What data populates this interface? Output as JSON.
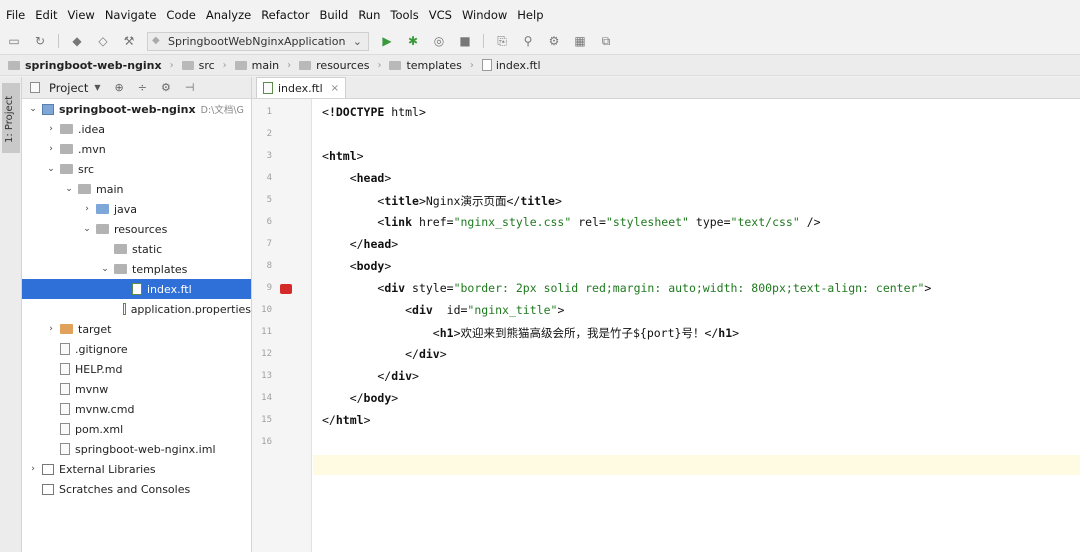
{
  "menu": [
    "File",
    "Edit",
    "View",
    "Navigate",
    "Code",
    "Analyze",
    "Refactor",
    "Build",
    "Run",
    "Tools",
    "VCS",
    "Window",
    "Help"
  ],
  "toolbar": {
    "run_configuration": "SpringbootWebNginxApplication",
    "icons": [
      "save-icon",
      "sync-icon",
      "back-icon",
      "forward-icon",
      "build-icon",
      "run-icon",
      "debug-icon",
      "coverage-icon",
      "stop-icon",
      "rebuild-icon",
      "wrench-icon",
      "settings-icon",
      "structure-icon",
      "vcs-icon"
    ]
  },
  "breadcrumb": [
    "springboot-web-nginx",
    "src",
    "main",
    "resources",
    "templates",
    "index.ftl"
  ],
  "left_tool_tab": "1: Project",
  "project_panel": {
    "title": "Project",
    "tree": [
      {
        "label": "springboot-web-nginx",
        "path": "D:\\文档\\G",
        "depth": 0,
        "arrow": "down",
        "icon": "module"
      },
      {
        "label": ".idea",
        "depth": 1,
        "arrow": "right",
        "icon": "folder"
      },
      {
        "label": ".mvn",
        "depth": 1,
        "arrow": "right",
        "icon": "folder"
      },
      {
        "label": "src",
        "depth": 1,
        "arrow": "down",
        "icon": "folder"
      },
      {
        "label": "main",
        "depth": 2,
        "arrow": "down",
        "icon": "folder"
      },
      {
        "label": "java",
        "depth": 3,
        "arrow": "right",
        "icon": "folder-blue"
      },
      {
        "label": "resources",
        "depth": 3,
        "arrow": "down",
        "icon": "folder"
      },
      {
        "label": "static",
        "depth": 4,
        "arrow": "",
        "icon": "folder"
      },
      {
        "label": "templates",
        "depth": 4,
        "arrow": "down",
        "icon": "folder"
      },
      {
        "label": "index.ftl",
        "depth": 5,
        "arrow": "",
        "icon": "file-ftl",
        "selected": true
      },
      {
        "label": "application.properties",
        "depth": 5,
        "arrow": "",
        "icon": "file-ftl"
      },
      {
        "label": "target",
        "depth": 1,
        "arrow": "right",
        "icon": "folder-orange"
      },
      {
        "label": ".gitignore",
        "depth": 1,
        "arrow": "",
        "icon": "file"
      },
      {
        "label": "HELP.md",
        "depth": 1,
        "arrow": "",
        "icon": "file"
      },
      {
        "label": "mvnw",
        "depth": 1,
        "arrow": "",
        "icon": "file"
      },
      {
        "label": "mvnw.cmd",
        "depth": 1,
        "arrow": "",
        "icon": "file"
      },
      {
        "label": "pom.xml",
        "depth": 1,
        "arrow": "",
        "icon": "file"
      },
      {
        "label": "springboot-web-nginx.iml",
        "depth": 1,
        "arrow": "",
        "icon": "file"
      },
      {
        "label": "External Libraries",
        "depth": 0,
        "arrow": "right",
        "icon": "library"
      },
      {
        "label": "Scratches and Consoles",
        "depth": 0,
        "arrow": "",
        "icon": "library"
      }
    ]
  },
  "editor": {
    "tab": "index.ftl",
    "breakpoint_line": 9,
    "lines": [
      "<!DOCTYPE html>",
      "",
      "<html>",
      "    <head>",
      "        <title>Nginx演示页面</title>",
      "        <link href=\"nginx_style.css\" rel=\"stylesheet\" type=\"text/css\" />",
      "    </head>",
      "    <body>",
      "        <div style=\"border: 2px solid red;margin: auto;width: 800px;text-align: center\">",
      "            <div  id=\"nginx_title\">",
      "                <h1>欢迎来到熊猫高级会所，我是竹子${port}号！</h1>",
      "            </div>",
      "        </div>",
      "    </body>",
      "</html>",
      ""
    ]
  }
}
